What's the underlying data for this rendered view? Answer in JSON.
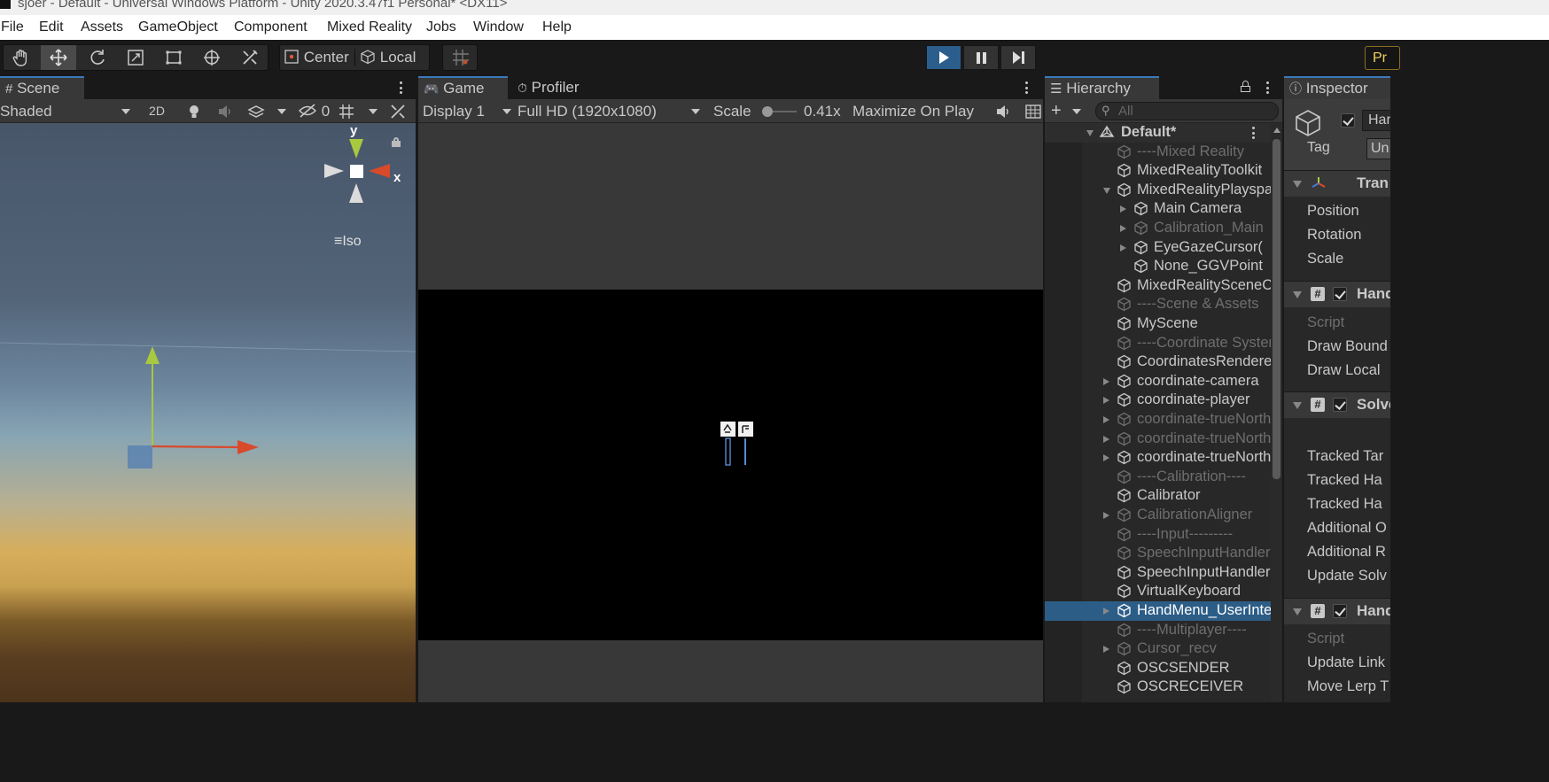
{
  "window": {
    "title": "sjoer - Default - Universal Windows Platform - Unity 2020.3.47f1 Personal* <DX11>"
  },
  "menu": [
    "File",
    "Edit",
    "Assets",
    "GameObject",
    "Component",
    "Mixed Reality",
    "Jobs",
    "Window",
    "Help"
  ],
  "toolbar": {
    "pivot_label": "Center",
    "space_label": "Local",
    "account_label": "Pr"
  },
  "scene": {
    "tab_label": "Scene",
    "shading_mode": "Shaded",
    "toggle_2d": "2D",
    "hidden_count": "0",
    "gizmo_y": "y",
    "gizmo_x": "x",
    "projection": "Iso"
  },
  "game": {
    "tab_label": "Game",
    "profiler_label": "Profiler",
    "display": "Display 1",
    "resolution": "Full HD (1920x1080)",
    "scale_label": "Scale",
    "scale_value": "0.41x",
    "maximize": "Maximize On Play"
  },
  "hierarchy": {
    "tab_label": "Hierarchy",
    "search_placeholder": "All",
    "scene_name": "Default*",
    "items": [
      {
        "label": "----Mixed Reality",
        "depth": 0,
        "dim": true,
        "arrow": "none"
      },
      {
        "label": "MixedRealityToolkit",
        "depth": 0,
        "dim": false,
        "arrow": "none"
      },
      {
        "label": "MixedRealityPlayspace",
        "depth": 0,
        "dim": false,
        "arrow": "open"
      },
      {
        "label": "Main Camera",
        "depth": 1,
        "dim": false,
        "arrow": "closed"
      },
      {
        "label": "Calibration_Main",
        "depth": 1,
        "dim": true,
        "arrow": "closed"
      },
      {
        "label": "EyeGazeCursor(",
        "depth": 1,
        "dim": false,
        "arrow": "closed"
      },
      {
        "label": "None_GGVPoint",
        "depth": 1,
        "dim": false,
        "arrow": "none"
      },
      {
        "label": "MixedRealitySceneContent",
        "depth": 0,
        "dim": false,
        "arrow": "none"
      },
      {
        "label": "----Scene & Assets",
        "depth": 0,
        "dim": true,
        "arrow": "none"
      },
      {
        "label": "MyScene",
        "depth": 0,
        "dim": false,
        "arrow": "none"
      },
      {
        "label": "----Coordinate System",
        "depth": 0,
        "dim": true,
        "arrow": "none"
      },
      {
        "label": "CoordinatesRenderer",
        "depth": 0,
        "dim": false,
        "arrow": "none"
      },
      {
        "label": "coordinate-camera",
        "depth": 0,
        "dim": false,
        "arrow": "closed"
      },
      {
        "label": "coordinate-player",
        "depth": 0,
        "dim": false,
        "arrow": "closed"
      },
      {
        "label": "coordinate-trueNorth",
        "depth": 0,
        "dim": true,
        "arrow": "closed"
      },
      {
        "label": "coordinate-trueNorth",
        "depth": 0,
        "dim": true,
        "arrow": "closed"
      },
      {
        "label": "coordinate-trueNorth",
        "depth": 0,
        "dim": false,
        "arrow": "closed"
      },
      {
        "label": "----Calibration----",
        "depth": 0,
        "dim": true,
        "arrow": "none"
      },
      {
        "label": "Calibrator",
        "depth": 0,
        "dim": false,
        "arrow": "none"
      },
      {
        "label": "CalibrationAligner",
        "depth": 0,
        "dim": true,
        "arrow": "closed"
      },
      {
        "label": "----Input---------",
        "depth": 0,
        "dim": true,
        "arrow": "none"
      },
      {
        "label": "SpeechInputHandler",
        "depth": 0,
        "dim": true,
        "arrow": "none"
      },
      {
        "label": "SpeechInputHandler",
        "depth": 0,
        "dim": false,
        "arrow": "none"
      },
      {
        "label": "VirtualKeyboard",
        "depth": 0,
        "dim": false,
        "arrow": "none"
      },
      {
        "label": "HandMenu_UserInterface",
        "depth": 0,
        "dim": false,
        "arrow": "closed",
        "selected": true
      },
      {
        "label": "----Multiplayer----",
        "depth": 0,
        "dim": true,
        "arrow": "none"
      },
      {
        "label": "Cursor_recv",
        "depth": 0,
        "dim": true,
        "arrow": "closed"
      },
      {
        "label": "OSCSENDER",
        "depth": 0,
        "dim": false,
        "arrow": "none"
      },
      {
        "label": "OSCRECEIVER",
        "depth": 0,
        "dim": false,
        "arrow": "none"
      }
    ]
  },
  "inspector": {
    "tab_label": "Inspector",
    "object_name": "Har",
    "tag_label": "Tag",
    "tag_value": "Un",
    "transform_header": "Tran",
    "transform_fields": [
      "Position",
      "Rotation",
      "Scale"
    ],
    "comp1_header": "Hand",
    "comp1_fields": [
      "Script",
      "Draw Bound",
      "Draw Local"
    ],
    "comp2_header": "Solve",
    "comp2_fields": [
      "Tracked Tar",
      "Tracked Ha",
      "Tracked Ha",
      "Additional O",
      "Additional R",
      "Update Solv"
    ],
    "comp3_header": "Hand",
    "comp3_fields": [
      "Script",
      "Update Link",
      "Move Lerp T"
    ]
  },
  "colors": {
    "selection": "#2c5d87",
    "play_active": "#2b5e8c",
    "tab_accent": "#3a79bb"
  }
}
